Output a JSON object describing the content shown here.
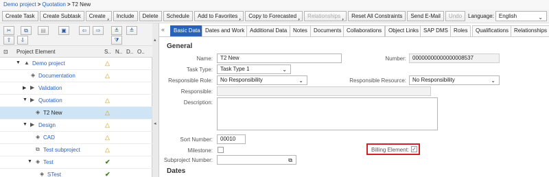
{
  "breadcrumb": {
    "items": [
      "Demo project",
      "Quotation",
      "T2 New"
    ],
    "sep": ">"
  },
  "toolbar": {
    "buttons": [
      "Create Task",
      "Create Subtask",
      "Create",
      "Include",
      "Delete",
      "Schedule",
      "Add to Favorites",
      "Copy to Forecasted",
      "Relationships",
      "Reset All Constraints",
      "Send E-Mail",
      "Undo"
    ],
    "language_label": "Language:",
    "language_value": "English"
  },
  "tree": {
    "columns": [
      "Project Element",
      "S..",
      "N..",
      "D..",
      "O.."
    ],
    "rows": [
      {
        "name": "Demo project",
        "status": "warn"
      },
      {
        "name": "Documentation",
        "status": "warn"
      },
      {
        "name": "Validation",
        "status": ""
      },
      {
        "name": "Quotation",
        "status": "warn"
      },
      {
        "name": "T2 New",
        "status": "warn"
      },
      {
        "name": "Design",
        "status": "warn"
      },
      {
        "name": "CAD",
        "status": "warn"
      },
      {
        "name": "Test subproject",
        "status": "warn"
      },
      {
        "name": "Test",
        "status": "ok"
      },
      {
        "name": "STest",
        "status": "ok"
      }
    ]
  },
  "tabs": [
    "Basic Data",
    "Dates and Work",
    "Additional Data",
    "Notes",
    "Documents",
    "Collaborations",
    "Object Links",
    "SAP DMS",
    "Roles",
    "Qualifications",
    "Relationships"
  ],
  "form": {
    "general_title": "General",
    "name_label": "Name:",
    "name_value": "T2 New",
    "number_label": "Number:",
    "number_value": "00000000000000008537",
    "task_type_label": "Task Type:",
    "task_type_value": "Task Type 1",
    "resp_role_label": "Responsible Role:",
    "resp_role_value": "No Responsibility",
    "resp_resource_label": "Responsible Resource:",
    "resp_resource_value": "No Responsibility",
    "responsible_label": "Responsible:",
    "description_label": "Description:",
    "sort_number_label": "Sort Number:",
    "sort_number_value": "00010",
    "milestone_label": "Milestone:",
    "billing_label": "Billing Element:",
    "subproject_label": "Subproject Number:",
    "dates_title": "Dates"
  },
  "colors": {
    "accent": "#2a62b8",
    "highlight_box": "#d2202a",
    "selected_row": "#cfe5f5"
  }
}
